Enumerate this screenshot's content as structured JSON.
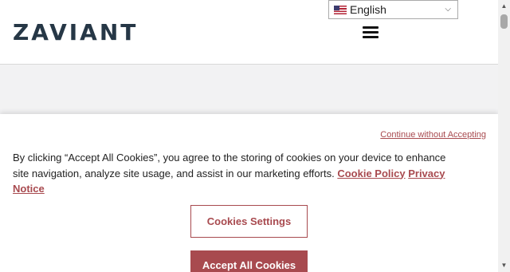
{
  "header": {
    "logo_text": "ZAVIANT",
    "language": {
      "selected": "English",
      "flag": "us-flag-icon"
    },
    "menu_icon": "hamburger-menu-icon"
  },
  "cookie_banner": {
    "continue_link": "Continue without Accepting",
    "text": "By clicking “Accept All Cookies”, you agree to the storing of cookies on your device to enhance site navigation, analyze site usage, and assist in our marketing efforts.",
    "cookie_policy_link": "Cookie Policy",
    "privacy_notice_link": "Privacy Notice",
    "settings_button": "Cookies Settings",
    "accept_button": "Accept All Cookies"
  },
  "colors": {
    "accent": "#a84a4f",
    "logo": "#263746",
    "background": "#f2f2f3"
  }
}
